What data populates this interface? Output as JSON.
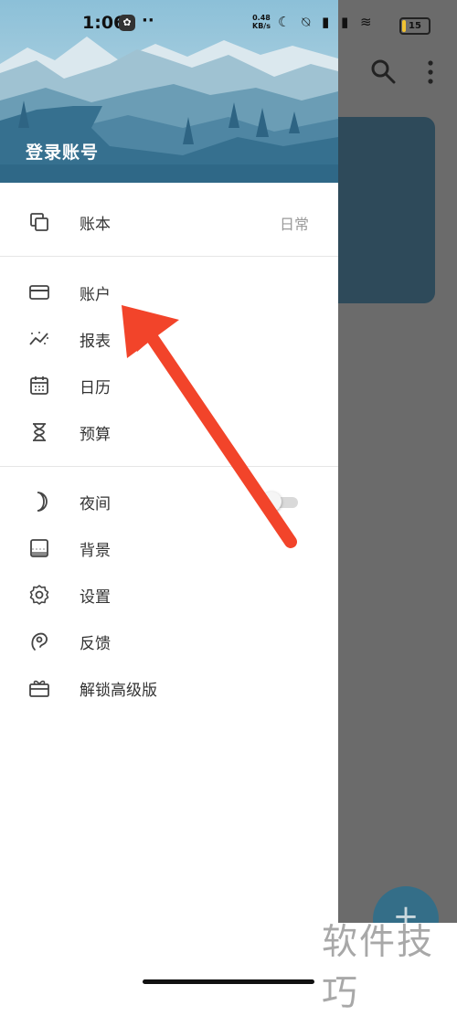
{
  "status_bar": {
    "time": "1:06",
    "dots": "··",
    "net_speed_value": "0.48",
    "net_speed_unit": "KB/s",
    "icons": "☾ ⍉ ▮ ▮ ≋",
    "battery": "15",
    "battery_level_percent": 15
  },
  "drawer": {
    "login_label": "登录账号",
    "ledger": {
      "label": "账本",
      "value": "日常"
    },
    "menu_group_1": [
      {
        "label": "账户",
        "icon": "card-icon"
      },
      {
        "label": "报表",
        "icon": "trend-icon"
      },
      {
        "label": "日历",
        "icon": "calendar-icon"
      },
      {
        "label": "预算",
        "icon": "hourglass-icon"
      }
    ],
    "menu_group_2": [
      {
        "label": "夜间",
        "icon": "moon-icon",
        "toggle": false
      },
      {
        "label": "背景",
        "icon": "image-icon"
      },
      {
        "label": "设置",
        "icon": "gear-icon"
      },
      {
        "label": "反馈",
        "icon": "feedback-icon"
      },
      {
        "label": "解锁高级版",
        "icon": "gift-icon"
      }
    ]
  },
  "background_app": {
    "fab_symbol": "+",
    "card_color": "#2e4a5a",
    "accent": "#2f6f8c"
  },
  "annotation": {
    "arrow_color": "#f2442a"
  },
  "watermark": "软件技巧"
}
